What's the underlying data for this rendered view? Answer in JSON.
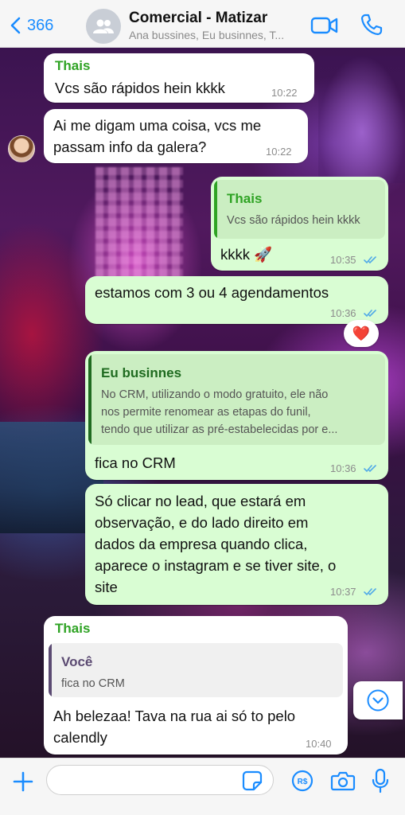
{
  "header": {
    "back_count": "366",
    "title": "Comercial - Matizar",
    "subtitle": "Ana bussines, Eu businnes, T..."
  },
  "messages": [
    {
      "direction": "in",
      "sender": "Thais",
      "text": "Vcs são rápidos hein kkkk",
      "time": "10:22"
    },
    {
      "direction": "in",
      "text_lines": [
        "Ai me digam uma coisa, vcs me",
        "passam info da galera?"
      ],
      "time": "10:22"
    },
    {
      "direction": "out",
      "quote": {
        "name": "Thais",
        "text": "Vcs são rápidos hein kkkk"
      },
      "text": "kkkk 🚀",
      "time": "10:35",
      "status": "read"
    },
    {
      "direction": "out",
      "text": "estamos com 3 ou 4 agendamentos",
      "time": "10:36",
      "status": "read",
      "reaction": "❤️"
    },
    {
      "direction": "out",
      "quote": {
        "name": "Eu businnes",
        "text_lines": [
          "No CRM, utilizando o modo gratuito, ele não",
          "nos permite renomear as etapas do funil,",
          "tendo que utilizar as pré-estabelecidas por e..."
        ]
      },
      "text": "fica no CRM",
      "time": "10:36",
      "status": "read"
    },
    {
      "direction": "out",
      "text_lines": [
        "Só clicar no lead, que estará em",
        "observação, e do lado direito em",
        "dados da empresa quando clica,",
        "aparece o instagram e se tiver site, o",
        "site"
      ],
      "time": "10:37",
      "status": "read"
    },
    {
      "direction": "in",
      "sender": "Thais",
      "quote": {
        "name": "Você",
        "text": "fica no CRM"
      },
      "text_lines": [
        "Ah belezaa! Tava na rua ai só to pelo",
        "calendly"
      ],
      "time": "10:40"
    }
  ],
  "composer": {
    "input_value": "",
    "input_placeholder": ""
  },
  "colors": {
    "accent_blue": "#1a8cff",
    "sender_green": "#2fa324",
    "out_bubble": "#d9fdd3",
    "in_bubble": "#ffffff",
    "read_ticks": "#4fa9e8"
  },
  "icons": {
    "back": "chevron-left-icon",
    "group_avatar": "group-icon",
    "video": "video-camera-icon",
    "call": "phone-icon",
    "scroll": "chevron-down-circle-icon",
    "plus": "plus-icon",
    "sticker": "sticker-icon",
    "pay": "payment-icon",
    "camera": "camera-icon",
    "mic": "microphone-icon"
  }
}
